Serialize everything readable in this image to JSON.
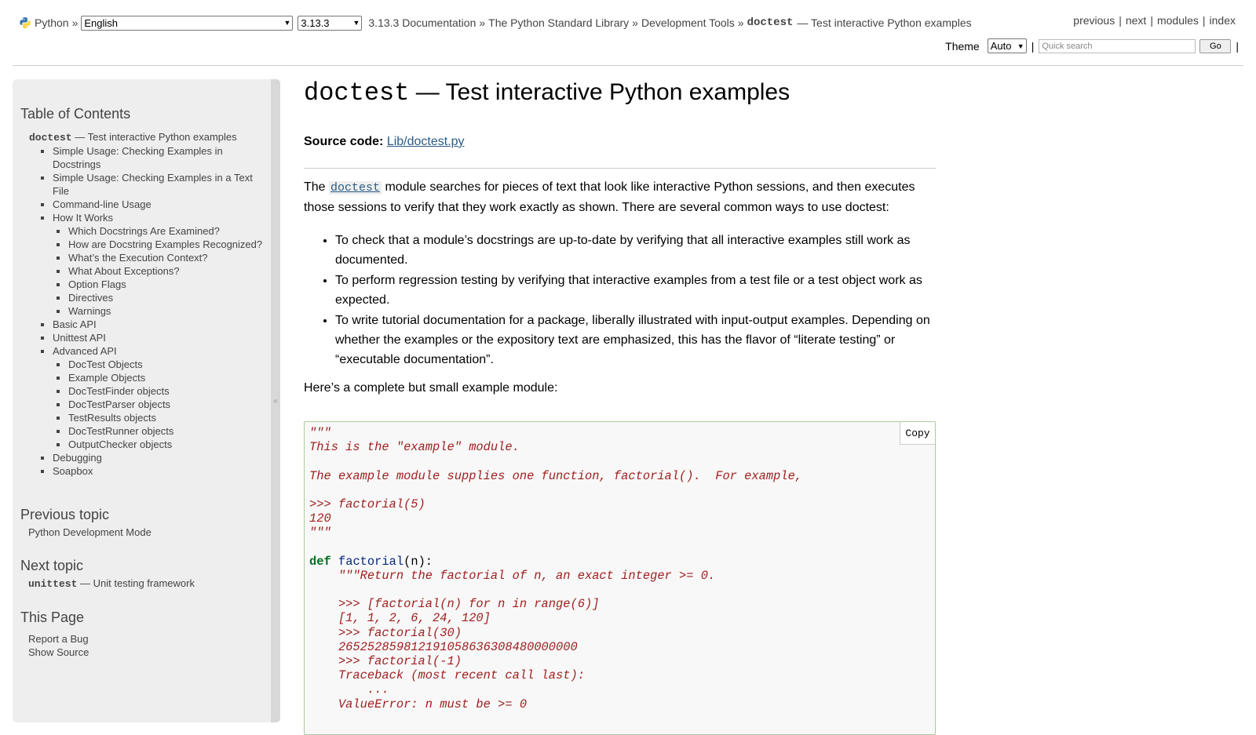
{
  "nav": {
    "home": "Python",
    "crumb_sep": "»",
    "language": "English",
    "version": "3.13.3",
    "crumbs": [
      "3.13.3 Documentation",
      "The Python Standard Library",
      "Development Tools"
    ],
    "current_code": "doctest",
    "current_rest": "— Test interactive Python examples",
    "right_links": [
      "previous",
      "next",
      "modules",
      "index"
    ],
    "bar": "|",
    "theme_label": "Theme",
    "theme_value": "Auto",
    "search_placeholder": "Quick search",
    "go_label": "Go",
    "collapse_glyph": "«"
  },
  "sidebar": {
    "toc_heading": "Table of Contents",
    "toc_root_code": "doctest",
    "toc_root_rest": "— Test interactive Python examples",
    "toc_items": [
      {
        "label": "Simple Usage: Checking Examples in Docstrings",
        "children": []
      },
      {
        "label": "Simple Usage: Checking Examples in a Text File",
        "children": []
      },
      {
        "label": "Command-line Usage",
        "children": []
      },
      {
        "label": "How It Works",
        "children": [
          "Which Docstrings Are Examined?",
          "How are Docstring Examples Recognized?",
          "What’s the Execution Context?",
          "What About Exceptions?",
          "Option Flags",
          "Directives",
          "Warnings"
        ]
      },
      {
        "label": "Basic API",
        "children": []
      },
      {
        "label": "Unittest API",
        "children": []
      },
      {
        "label": "Advanced API",
        "children": [
          "DocTest Objects",
          "Example Objects",
          "DocTestFinder objects",
          "DocTestParser objects",
          "TestResults objects",
          "DocTestRunner objects",
          "OutputChecker objects"
        ]
      },
      {
        "label": "Debugging",
        "children": []
      },
      {
        "label": "Soapbox",
        "children": []
      }
    ],
    "prev_heading": "Previous topic",
    "prev_link": "Python Development Mode",
    "next_heading": "Next topic",
    "next_link_code": "unittest",
    "next_link_rest": "— Unit testing framework",
    "this_page_heading": "This Page",
    "this_page_links": [
      "Report a Bug",
      "Show Source"
    ]
  },
  "main": {
    "title_code": "doctest",
    "title_rest": "— Test interactive Python examples",
    "source_label": "Source code:",
    "source_link": "Lib/doctest.py",
    "intro_before": "The ",
    "intro_link": "doctest",
    "intro_after": " module searches for pieces of text that look like interactive Python sessions, and then executes those sessions to verify that they work exactly as shown. There are several common ways to use doctest:",
    "bullets": [
      "To check that a module’s docstrings are up-to-date by verifying that all interactive examples still work as documented.",
      "To perform regression testing by verifying that interactive examples from a test file or a test object work as expected.",
      "To write tutorial documentation for a package, liberally illustrated with input-output examples. Depending on whether the examples or the expository text are emphasized, this has the flavor of “literate testing” or “executable documentation”."
    ],
    "example_intro": "Here’s a complete but small example module:",
    "copy_label": "Copy",
    "code_lines": [
      {
        "t": "str",
        "text": "\"\"\""
      },
      {
        "t": "str",
        "text": "This is the \"example\" module."
      },
      {
        "t": "str",
        "text": ""
      },
      {
        "t": "str",
        "text": "The example module supplies one function, factorial().  For example,"
      },
      {
        "t": "str",
        "text": ""
      },
      {
        "t": "str",
        "text": ">>> factorial(5)"
      },
      {
        "t": "str",
        "text": "120"
      },
      {
        "t": "str",
        "text": "\"\"\""
      },
      {
        "t": "plain",
        "text": ""
      },
      {
        "t": "def",
        "kw": "def",
        "fn": "factorial",
        "rest": "(n):"
      },
      {
        "t": "str",
        "text": "    \"\"\"Return the factorial of n, an exact integer >= 0."
      },
      {
        "t": "str",
        "text": ""
      },
      {
        "t": "str",
        "text": "    >>> [factorial(n) for n in range(6)]"
      },
      {
        "t": "str",
        "text": "    [1, 1, 2, 6, 24, 120]"
      },
      {
        "t": "str",
        "text": "    >>> factorial(30)"
      },
      {
        "t": "str",
        "text": "    265252859812191058636308480000000"
      },
      {
        "t": "str",
        "text": "    >>> factorial(-1)"
      },
      {
        "t": "str",
        "text": "    Traceback (most recent call last):"
      },
      {
        "t": "str",
        "text": "        ..."
      },
      {
        "t": "str",
        "text": "    ValueError: n must be >= 0"
      }
    ]
  }
}
